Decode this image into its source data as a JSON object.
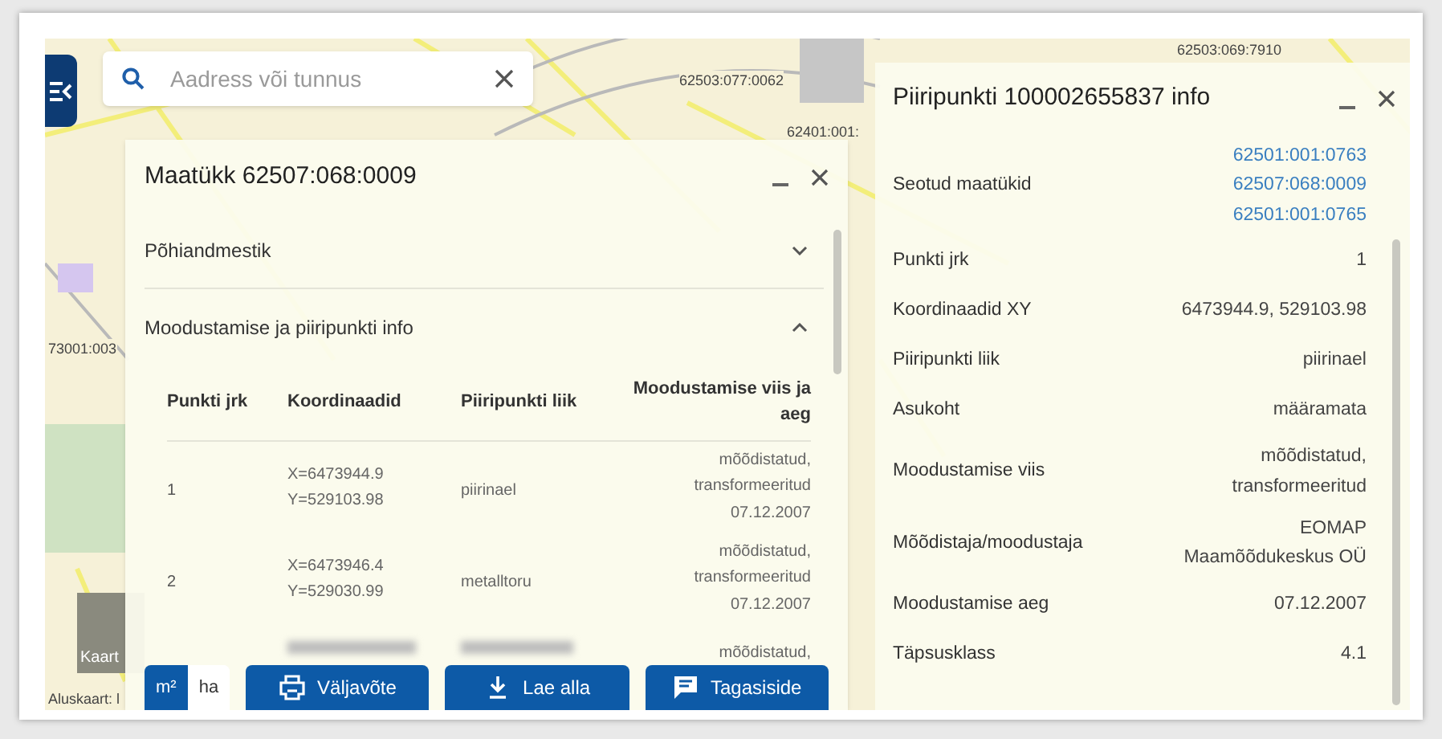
{
  "map": {
    "labels": [
      "62503:077:0062",
      "62503:069:7910",
      "62401:001:",
      "73001:003",
      "Aluskaart: l"
    ],
    "thumbnail_label": "Kaart"
  },
  "search": {
    "placeholder": "Aadress või tunnus"
  },
  "parcel_panel": {
    "title": "Maatükk 62507:068:0009",
    "sections": [
      {
        "label": "Põhiandmestik",
        "expanded": false
      },
      {
        "label": "Moodustamise ja piiripunkti info",
        "expanded": true
      }
    ],
    "table": {
      "columns": [
        "Punkti jrk",
        "Koordinaadid",
        "Piiripunkti liik",
        "Moodustamise viis ja aeg"
      ],
      "rows": [
        {
          "number": "1",
          "coordinates": [
            "X=6473944.9",
            "Y=529103.98"
          ],
          "type": "piirinael",
          "method": [
            "mõõdistatud,",
            "transformeeritud",
            "07.12.2007"
          ]
        },
        {
          "number": "2",
          "coordinates": [
            "X=6473946.4",
            "Y=529030.99"
          ],
          "type": "metalltoru",
          "method": [
            "mõõdistatud,",
            "transformeeritud",
            "07.12.2007"
          ]
        },
        {
          "number": "",
          "coordinates": [],
          "type": "",
          "method": [
            "mõõdistatud,"
          ]
        }
      ]
    },
    "units": [
      {
        "label": "m²",
        "selected": true
      },
      {
        "label": "ha",
        "selected": false
      }
    ],
    "buttons": [
      "Väljavõte",
      "Lae alla",
      "Tagasiside"
    ]
  },
  "point_panel": {
    "title": "Piiripunkti 100002655837 info",
    "fields": [
      {
        "label": "Seotud maatükid",
        "kind": "links",
        "values": [
          "62501:001:0763",
          "62507:068:0009",
          "62501:001:0765"
        ]
      },
      {
        "label": "Punkti jrk",
        "kind": "text",
        "values": [
          "1"
        ]
      },
      {
        "label": "Koordinaadid XY",
        "kind": "text",
        "values": [
          "6473944.9, 529103.98"
        ]
      },
      {
        "label": "Piiripunkti liik",
        "kind": "text",
        "values": [
          "piirinael"
        ]
      },
      {
        "label": "Asukoht",
        "kind": "text",
        "values": [
          "määramata"
        ]
      },
      {
        "label": "Moodustamise viis",
        "kind": "text",
        "values": [
          "mõõdistatud,",
          "transformeeritud"
        ]
      },
      {
        "label": "Mõõdistaja/moodustaja",
        "kind": "text",
        "values": [
          "EOMAP",
          "Maamõõdukeskus OÜ"
        ]
      },
      {
        "label": "Moodustamise aeg",
        "kind": "text",
        "values": [
          "07.12.2007"
        ]
      },
      {
        "label": "Täpsusklass",
        "kind": "text",
        "values": [
          "4.1"
        ]
      }
    ]
  }
}
